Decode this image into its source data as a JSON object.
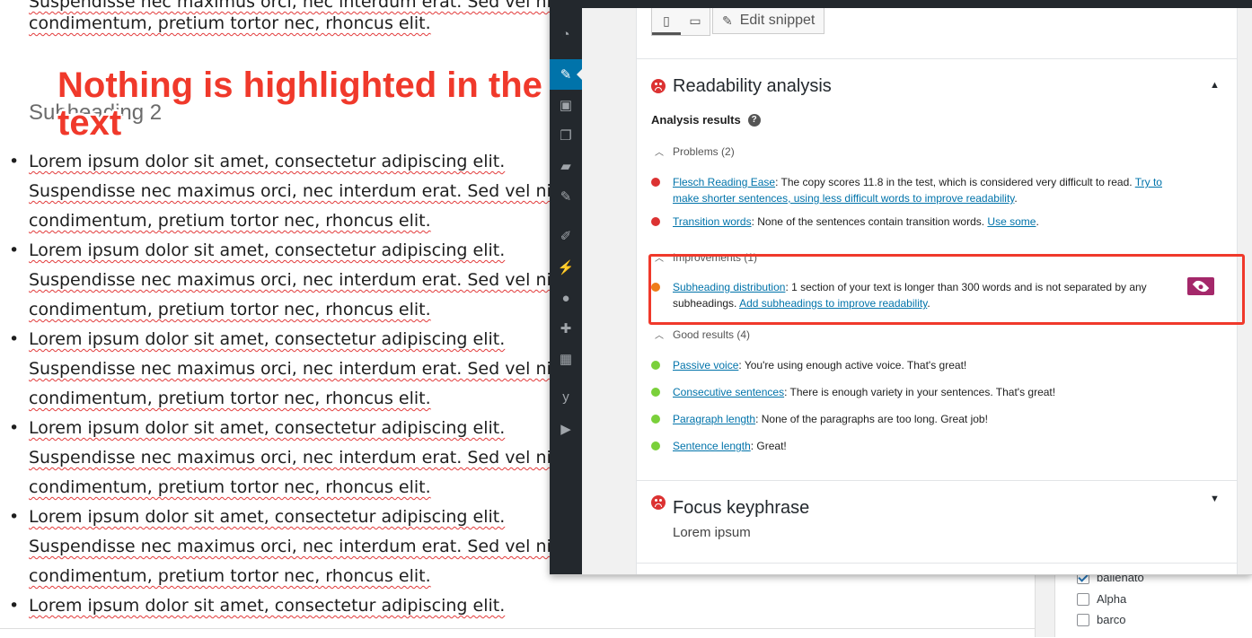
{
  "editor": {
    "top_partial": "Suspendisse nec maximus orci, nec interdum erat. Sed vel nisi",
    "line_a": "Lorem ipsum dolor sit amet, consectetur adipiscing elit.",
    "line_b": "Suspendisse nec maximus orci, nec interdum erat. Sed vel nisi",
    "line_c": "condimentum, pretium tortor nec, rhoncus elit.",
    "subheading": "Subheading 2",
    "callout": "Nothing is highlighted in the text",
    "bullet": "•"
  },
  "toolbar": {
    "mobile_icon": "mobile-icon",
    "desktop_icon": "desktop-icon",
    "edit_snippet_label": "Edit snippet"
  },
  "readability": {
    "title": "Readability analysis",
    "analysis_results_label": "Analysis results",
    "help_glyph": "?",
    "problems_label": "Problems (2)",
    "problems": [
      {
        "link": "Flesch Reading Ease",
        "text": ": The copy scores 11.8 in the test, which is considered very difficult to read. ",
        "action": "Try to make shorter sentences, using less difficult words to improve readability",
        "end": "."
      },
      {
        "link": "Transition words",
        "text": ": None of the sentences contain transition words. ",
        "action": "Use some",
        "end": "."
      }
    ],
    "improvements_label": "Improvements (1)",
    "improvements": [
      {
        "link": "Subheading distribution",
        "text": ": 1 section of your text is longer than 300 words and is not separated by any subheadings. ",
        "action": "Add subheadings to improve readability",
        "end": "."
      }
    ],
    "good_label": "Good results (4)",
    "good": [
      {
        "link": "Passive voice",
        "text": ": You're using enough active voice. That's great!"
      },
      {
        "link": "Consecutive sentences",
        "text": ": There is enough variety in your sentences. That's great!"
      },
      {
        "link": "Paragraph length",
        "text": ": None of the paragraphs are too long. Great job!"
      },
      {
        "link": "Sentence length",
        "text": ": Great!"
      }
    ]
  },
  "focus": {
    "title": "Focus keyphrase",
    "value": "Lorem ipsum"
  },
  "categories": [
    {
      "label": "ballenato",
      "checked": true
    },
    {
      "label": "Alpha",
      "checked": false
    },
    {
      "label": "barco",
      "checked": false
    }
  ],
  "colors": {
    "problem": "#dc3232",
    "improvement": "#ee7c1b",
    "good": "#7ad03a",
    "link": "#0073aa",
    "eye_button": "#a4286a",
    "callout": "#f0392b",
    "highlight_box": "#f0392b"
  }
}
